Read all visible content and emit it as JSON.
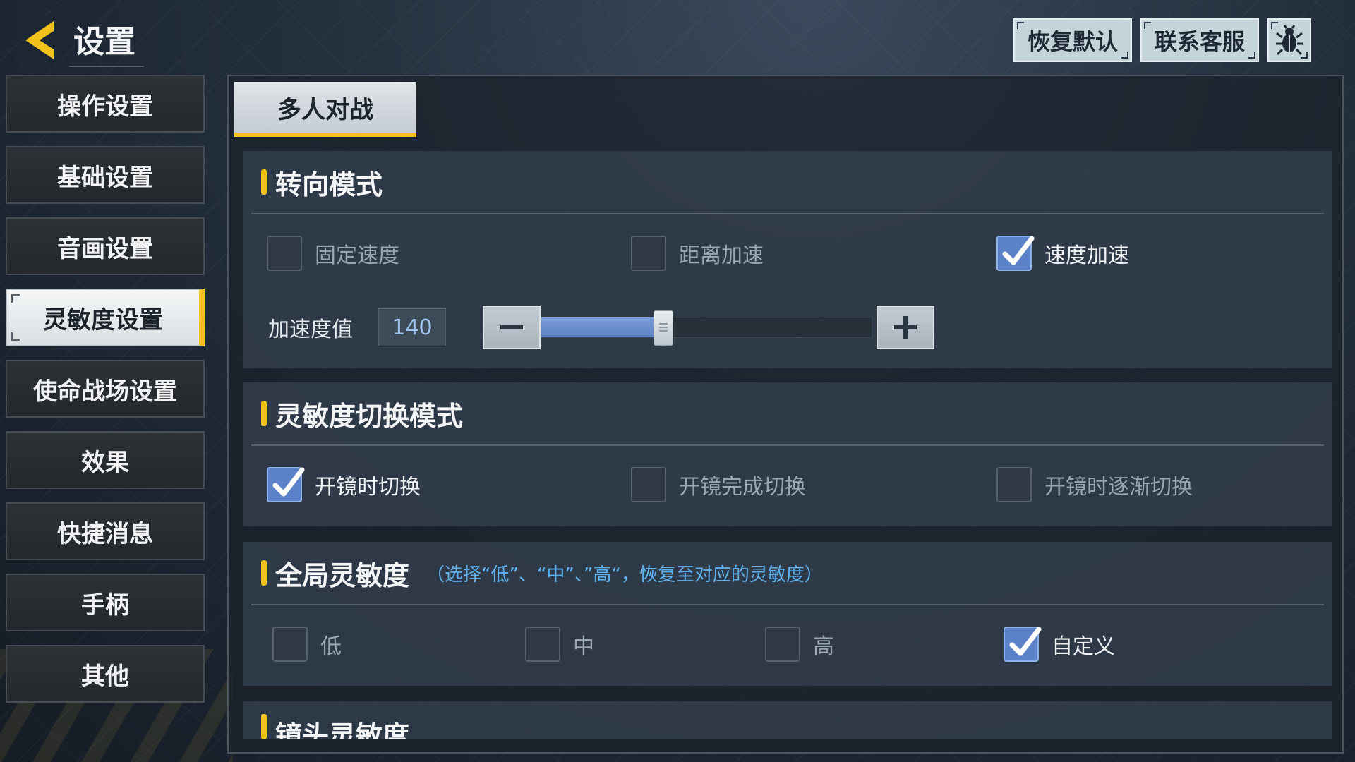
{
  "header": {
    "title": "设置",
    "restore_default": "恢复默认",
    "contact_service": "联系客服",
    "bug_icon": "bug-icon",
    "back_icon": "back-arrow-icon"
  },
  "sidebar": {
    "items": [
      {
        "label": "操作设置",
        "active": false
      },
      {
        "label": "基础设置",
        "active": false
      },
      {
        "label": "音画设置",
        "active": false
      },
      {
        "label": "灵敏度设置",
        "active": true
      },
      {
        "label": "使命战场设置",
        "active": false
      },
      {
        "label": "效果",
        "active": false
      },
      {
        "label": "快捷消息",
        "active": false
      },
      {
        "label": "手柄",
        "active": false
      },
      {
        "label": "其他",
        "active": false
      }
    ]
  },
  "tabs": [
    {
      "label": "多人对战",
      "active": true
    }
  ],
  "turn_mode": {
    "title": "转向模式",
    "options": [
      {
        "label": "固定速度",
        "checked": false
      },
      {
        "label": "距离加速",
        "checked": false
      },
      {
        "label": "速度加速",
        "checked": true
      }
    ],
    "accel_label": "加速度值",
    "accel_value": "140",
    "accel_fraction": 0.37
  },
  "switch_mode": {
    "title": "灵敏度切换模式",
    "options": [
      {
        "label": "开镜时切换",
        "checked": true
      },
      {
        "label": "开镜完成切换",
        "checked": false
      },
      {
        "label": "开镜时逐渐切换",
        "checked": false
      }
    ]
  },
  "global_sens": {
    "title": "全局灵敏度",
    "note": "（选择“低”、“中”、”高“，恢复至对应的灵敏度）",
    "options": [
      {
        "label": "低",
        "checked": false
      },
      {
        "label": "中",
        "checked": false
      },
      {
        "label": "高",
        "checked": false
      },
      {
        "label": "自定义",
        "checked": true
      }
    ]
  },
  "lens_sens": {
    "title": "镜头灵敏度"
  },
  "colors": {
    "accent_yellow": "#f2c11c",
    "checkbox_blue": "#5b82c9",
    "note_blue": "#5fb1ee"
  }
}
